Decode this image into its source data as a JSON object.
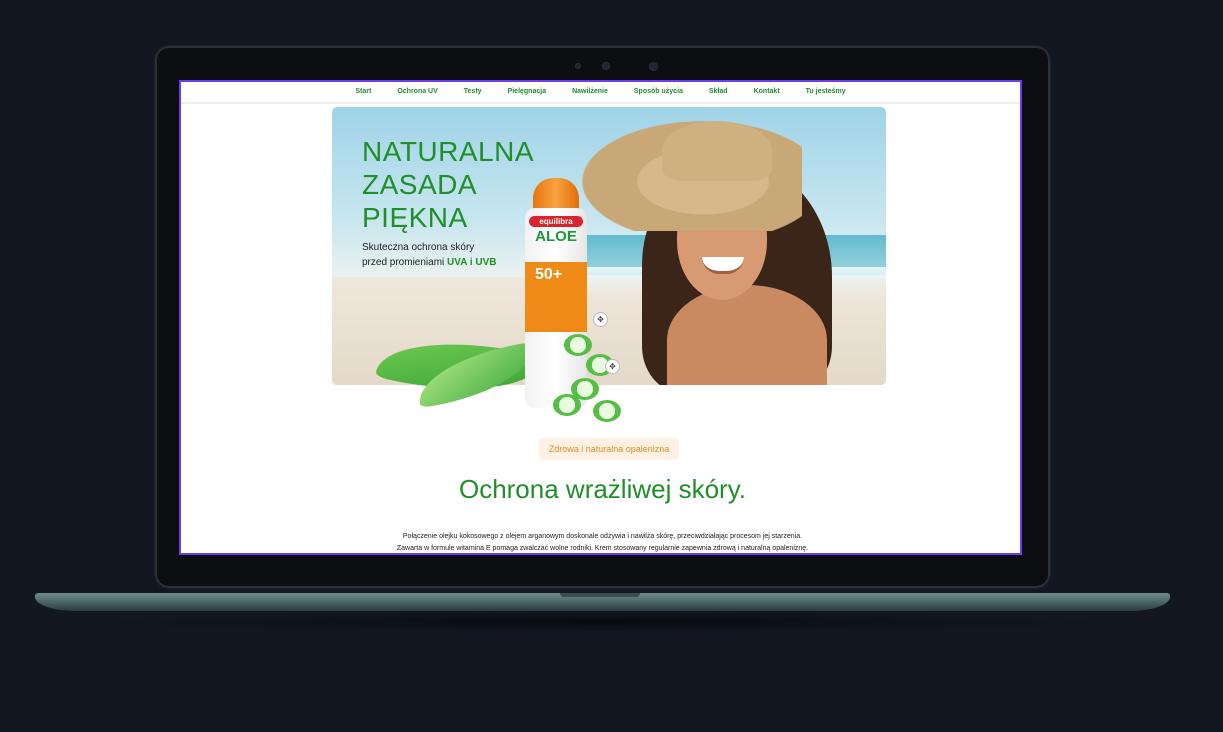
{
  "nav": {
    "items": [
      "Start",
      "Ochrona UV",
      "Testy",
      "Pielęgnacja",
      "Nawilżenie",
      "Sposób użycia",
      "Skład",
      "Kontakt",
      "Tu jesteśmy"
    ]
  },
  "hero": {
    "title_lines": [
      "NATURALNA",
      "ZASADA",
      "PIĘKNA"
    ],
    "subtitle_line1": "Skuteczna ochrona skóry",
    "subtitle_line2_prefix": "przed promieniami ",
    "subtitle_line2_highlight": "UVA i UVB",
    "product": {
      "brand": "equilibra",
      "name": "ALOE",
      "spf": "50+"
    }
  },
  "badge": "Zdrowa i naturalna opalenizna",
  "section": {
    "heading": "Ochrona wrażliwej skóry.",
    "para_line1": "Połączenie olejku kokosowego z olejem arganowym doskonale odżywia i nawilża skórę, przeciwdziałając procesom jej starzenia.",
    "para_line2": "Zawarta w formule witamina E pomaga zwalczać wolne rodniki. Krem stosowany regularnie zapewnia zdrową i naturalną opaleniznę."
  },
  "colors": {
    "accent_green": "#1f8f2a",
    "badge_bg": "#fff1e3",
    "badge_text": "#e88d1a",
    "screen_border": "#6a3df0",
    "background": "#121722"
  },
  "icons": [
    "move-handle-icon",
    "move-handle-icon"
  ]
}
